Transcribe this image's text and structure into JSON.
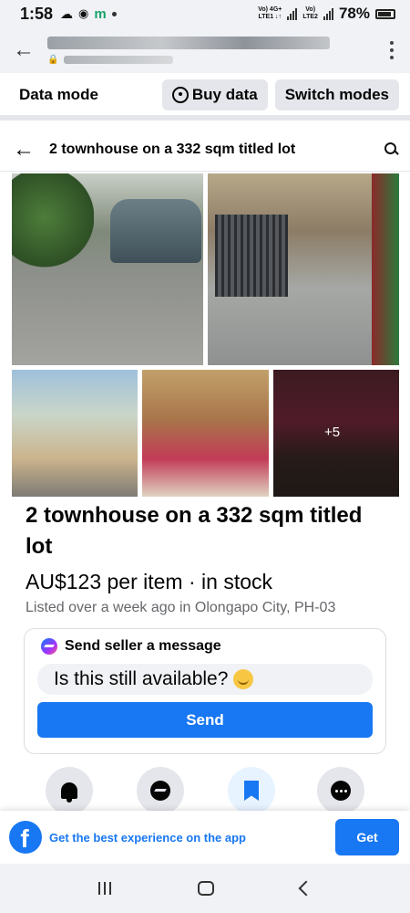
{
  "status_bar": {
    "time": "1:58",
    "network_1": "Vo) 4G+",
    "network_1_sub": "LTE1 ↓↑",
    "network_2": "Vo)",
    "network_2_sub": "LTE2",
    "battery": "78%",
    "notif_icon": "m"
  },
  "browser": {
    "more_icon": "more-vertical-icon"
  },
  "data_mode": {
    "label": "Data mode",
    "buy_data": "Buy data",
    "switch_modes": "Switch modes"
  },
  "header": {
    "back": "←",
    "title": "2 townhouse on a 332 sqm titled lot"
  },
  "photos": {
    "extra_count": "+5"
  },
  "listing": {
    "title": "2 townhouse on a 332 sqm titled lot",
    "price": "AU$123 per item · in stock",
    "location": "Listed over a week ago in Olongapo City, PH-03"
  },
  "message": {
    "heading": "Send seller a message",
    "input_value": "Is this still available?",
    "send_label": "Send"
  },
  "banner": {
    "logo": "f",
    "text": "Get the best experience on the app",
    "get_label": "Get"
  },
  "colors": {
    "accent": "#1877f2",
    "background": "#f0f2f5"
  }
}
